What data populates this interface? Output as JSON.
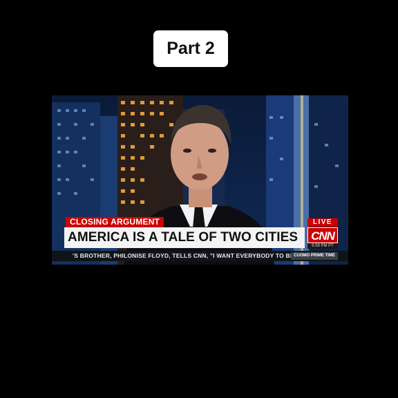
{
  "overlay": {
    "part_label": "Part 2"
  },
  "video": {
    "chyron": {
      "label": "CLOSING ARGUMENT",
      "headline": "AMERICA IS A TALE OF TWO CITIES"
    },
    "network": {
      "live": "LIVE",
      "logo": "CNN",
      "time": "6:58 PM PT"
    },
    "ticker": {
      "text": "'S BROTHER, PHILONISE FLOYD, TELLS CNN, \"I WANT EVERYBODY TO BE PE",
      "show": "CUOMO PRIME TIME"
    },
    "colors": {
      "brand_red": "#cc0000",
      "chyron_bg": "#f4f4f4"
    }
  }
}
